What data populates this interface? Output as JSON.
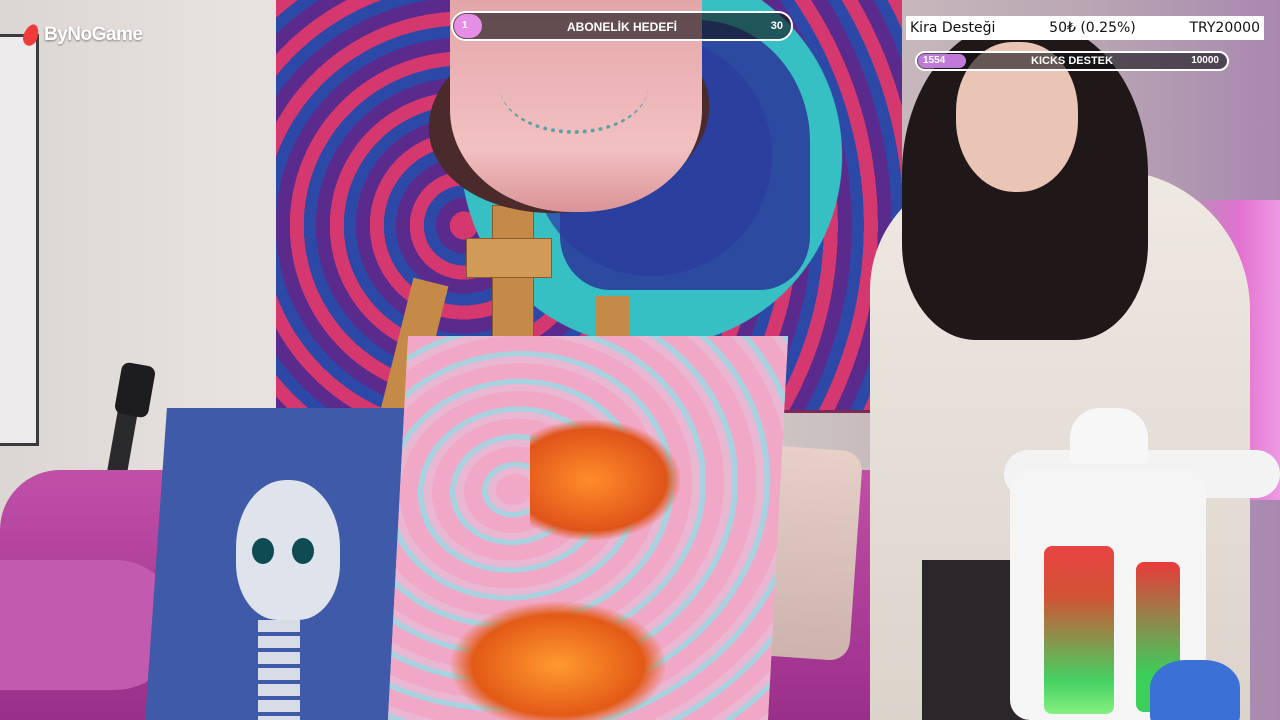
{
  "logo": {
    "text": "ByNoGame",
    "accent": "#ef3b3b"
  },
  "subscriber_goal": {
    "title": "ABONELİK HEDEFİ",
    "current": "1",
    "target": "30",
    "progress": 0.033,
    "fill_color": "#e58ee6"
  },
  "rent_support": {
    "label": "Kira Desteği",
    "amount": "50₺ (0.25%)",
    "goal": "TRY20000"
  },
  "kicks_support": {
    "title": "KICKS DESTEK",
    "current": "1554",
    "target": "10000",
    "progress": 0.155,
    "fill_color": "#c07ad8"
  },
  "scene": {
    "description_icon": "webcam-feed"
  }
}
